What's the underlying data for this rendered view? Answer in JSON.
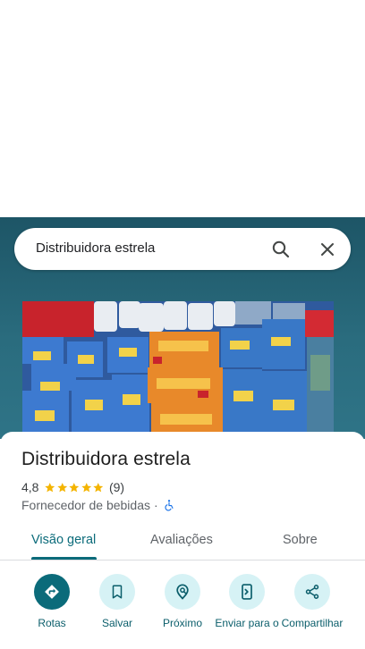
{
  "search": {
    "query": "Distribuidora estrela",
    "search_icon": "search-icon",
    "close_icon": "close-icon"
  },
  "place": {
    "name": "Distribuidora estrela",
    "rating": "4,8",
    "stars": 5,
    "review_count": "(9)",
    "category": "Fornecedor de bebidas",
    "separator": "·",
    "accessibility_icon": "wheelchair-icon"
  },
  "tabs": [
    {
      "label": "Visão geral",
      "active": true
    },
    {
      "label": "Avaliações",
      "active": false
    },
    {
      "label": "Sobre",
      "active": false
    }
  ],
  "actions": [
    {
      "label": "Rotas",
      "icon": "directions-icon"
    },
    {
      "label": "Salvar",
      "icon": "bookmark-icon"
    },
    {
      "label": "Próximo",
      "icon": "nearby-icon"
    },
    {
      "label": "Enviar para o",
      "icon": "send-to-phone-icon"
    },
    {
      "label": "Compartilhar",
      "icon": "share-icon"
    }
  ],
  "colors": {
    "accent": "#0b6b7a",
    "action_bg": "#d6f2f5",
    "star": "#f4b400",
    "accessibility": "#1a73e8",
    "header_band": "#2a6c7e"
  }
}
